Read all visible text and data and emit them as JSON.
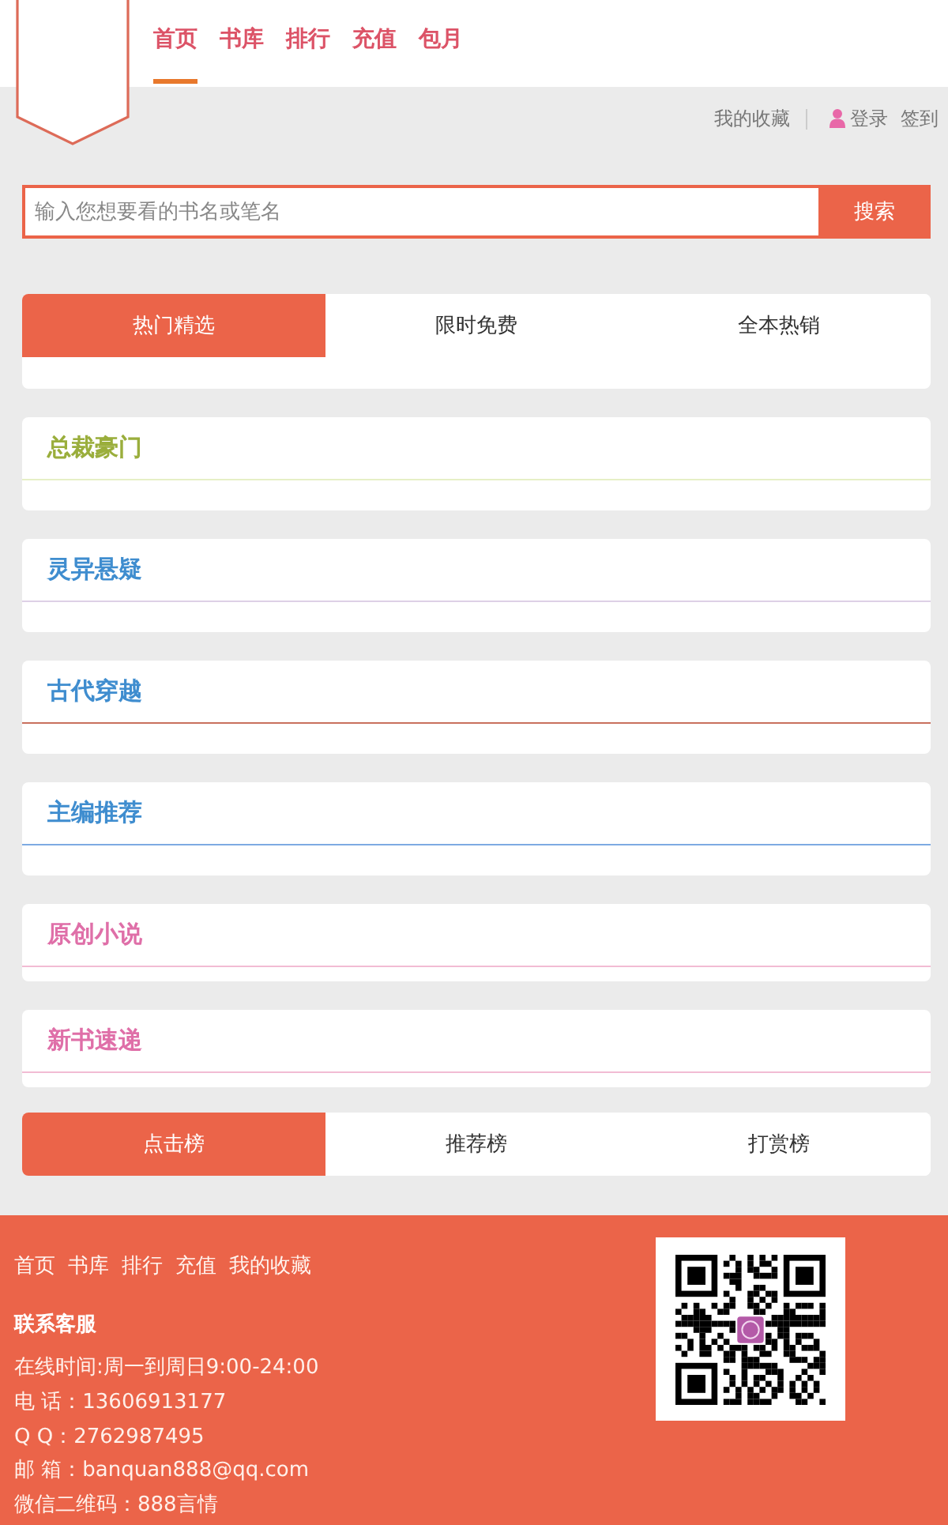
{
  "header": {
    "nav": [
      {
        "label": "首页",
        "selected": true
      },
      {
        "label": "书库",
        "selected": false
      },
      {
        "label": "排行",
        "selected": false
      },
      {
        "label": "充值",
        "selected": false
      },
      {
        "label": "包月",
        "selected": false
      }
    ]
  },
  "user_links": {
    "favorites": "我的收藏",
    "login": "登录",
    "sign_in": "签到"
  },
  "search": {
    "placeholder": "输入您想要看的书名或笔名",
    "button": "搜索"
  },
  "featured_tabs": [
    {
      "label": "热门精选",
      "selected": true
    },
    {
      "label": "限时免费",
      "selected": false
    },
    {
      "label": "全本热销",
      "selected": false
    }
  ],
  "sections": [
    {
      "title": "总裁豪门",
      "color": "#9aae3c",
      "divider": {
        "color": "#e6efc6"
      }
    },
    {
      "title": "灵异悬疑",
      "color": "#3f8dcf",
      "divider": {
        "color": "#ddd0e6"
      }
    },
    {
      "title": "古代穿越",
      "color": "#3f8dcf",
      "divider": {
        "color": "#c8705e"
      }
    },
    {
      "title": "主编推荐",
      "color": "#3f8dcf",
      "divider": {
        "color": "#7eaae2"
      }
    },
    {
      "title": "原创小说",
      "color": "#df6fa8",
      "divider": {
        "color": "#f2bcd4"
      }
    },
    {
      "title": "新书速递",
      "color": "#df6fa8",
      "divider": {
        "color": "#f2bcd4"
      }
    }
  ],
  "rank_tabs": [
    {
      "label": "点击榜",
      "selected": true
    },
    {
      "label": "推荐榜",
      "selected": false
    },
    {
      "label": "打赏榜",
      "selected": false
    }
  ],
  "footer": {
    "links": [
      "首页",
      "书库",
      "排行",
      "充值",
      "我的收藏"
    ],
    "contact_title": "联系客服",
    "lines": [
      "在线时间:周一到周日9:00-24:00",
      "电 话：13606913177",
      "Q Q：2762987495",
      "邮 箱：banquan888@qq.com",
      "微信二维码：888言情"
    ]
  }
}
